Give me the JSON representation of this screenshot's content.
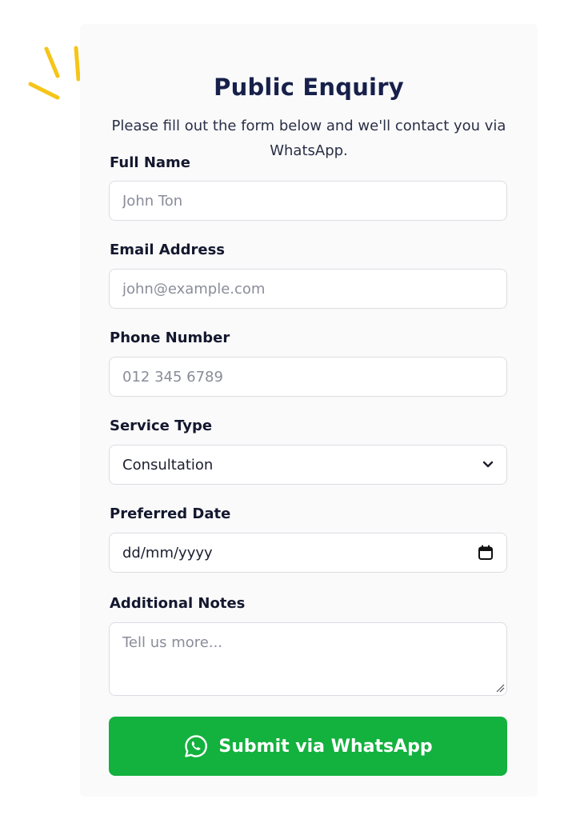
{
  "form": {
    "title": "Public Enquiry",
    "subtitle": "Please fill out the form below and we'll contact you via WhatsApp.",
    "fields": {
      "full_name": {
        "label": "Full Name",
        "placeholder": "John Ton",
        "value": ""
      },
      "email": {
        "label": "Email Address",
        "placeholder": "john@example.com",
        "value": ""
      },
      "phone": {
        "label": "Phone Number",
        "placeholder": "012 345 6789",
        "value": ""
      },
      "service_type": {
        "label": "Service Type",
        "selected": "Consultation"
      },
      "preferred_date": {
        "label": "Preferred Date",
        "value": "dd/mm/yyyy"
      },
      "notes": {
        "label": "Additional Notes",
        "placeholder": "Tell us more...",
        "value": ""
      }
    },
    "submit": {
      "label": "Submit via WhatsApp",
      "icon": "whatsapp-icon"
    }
  },
  "decoration": {
    "icon": "sparkle-lines-icon"
  },
  "colors": {
    "accent_green": "#13b13e",
    "title_navy": "#17204a",
    "sparkle_yellow": "#f5c518",
    "card_background": "#fafafb",
    "field_border": "#dcdde3"
  }
}
